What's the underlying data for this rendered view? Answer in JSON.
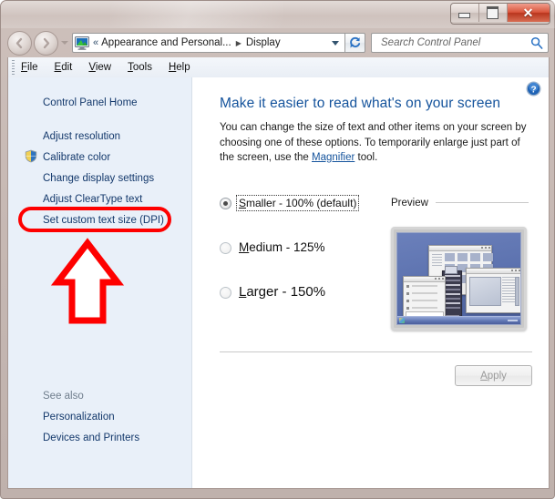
{
  "window": {
    "title": "Display",
    "controls": {
      "minimize": "Minimize",
      "maximize": "Maximize",
      "close": "Close",
      "close_glyph": "✕"
    }
  },
  "navigation": {
    "back_label": "Back",
    "forward_label": "Forward",
    "recent_pages_label": "Recent pages",
    "breadcrumb": {
      "overflow": "«",
      "separator": "▶",
      "items": [
        "Appearance and Personal...",
        "Display"
      ]
    },
    "address_dropdown_label": "Previous locations",
    "refresh_label": "Refresh"
  },
  "search": {
    "placeholder": "Search Control Panel",
    "value": "",
    "icon": "search-icon"
  },
  "menubar": {
    "items": [
      {
        "accel": "F",
        "rest": "ile"
      },
      {
        "accel": "E",
        "rest": "dit"
      },
      {
        "accel": "V",
        "rest": "iew"
      },
      {
        "accel": "T",
        "rest": "ools"
      },
      {
        "accel": "H",
        "rest": "elp"
      }
    ]
  },
  "sidebar": {
    "home": "Control Panel Home",
    "items": [
      {
        "label": "Adjust resolution",
        "icon": null
      },
      {
        "label": "Calibrate color",
        "icon": "uac-shield-icon"
      },
      {
        "label": "Change display settings",
        "icon": null
      },
      {
        "label": "Adjust ClearType text",
        "icon": null
      },
      {
        "label": "Set custom text size (DPI)",
        "icon": null,
        "highlighted": true
      }
    ],
    "see_also": {
      "title": "See also",
      "items": [
        "Personalization",
        "Devices and Printers"
      ]
    }
  },
  "content": {
    "help_icon": "help-icon",
    "title": "Make it easier to read what's on your screen",
    "description_part1": "You can change the size of text and other items on your screen by choosing one of these options. To temporarily enlarge just part of the screen, use the ",
    "description_link": "Magnifier",
    "description_part2": " tool.",
    "options": [
      {
        "accel": "S",
        "rest": "maller - 100% (default)",
        "selected": true,
        "focused": true
      },
      {
        "accel": "M",
        "rest": "edium - 125%",
        "selected": false,
        "focused": false
      },
      {
        "accel": "L",
        "rest": "arger - 150%",
        "selected": false,
        "focused": false
      }
    ],
    "preview_label": "Preview",
    "apply": {
      "accel": "A",
      "rest": "pply",
      "enabled": false
    }
  },
  "annotations": {
    "highlight_color": "#ff0000",
    "ellipse_target": "Set custom text size (DPI)",
    "arrow_direction": "up"
  }
}
